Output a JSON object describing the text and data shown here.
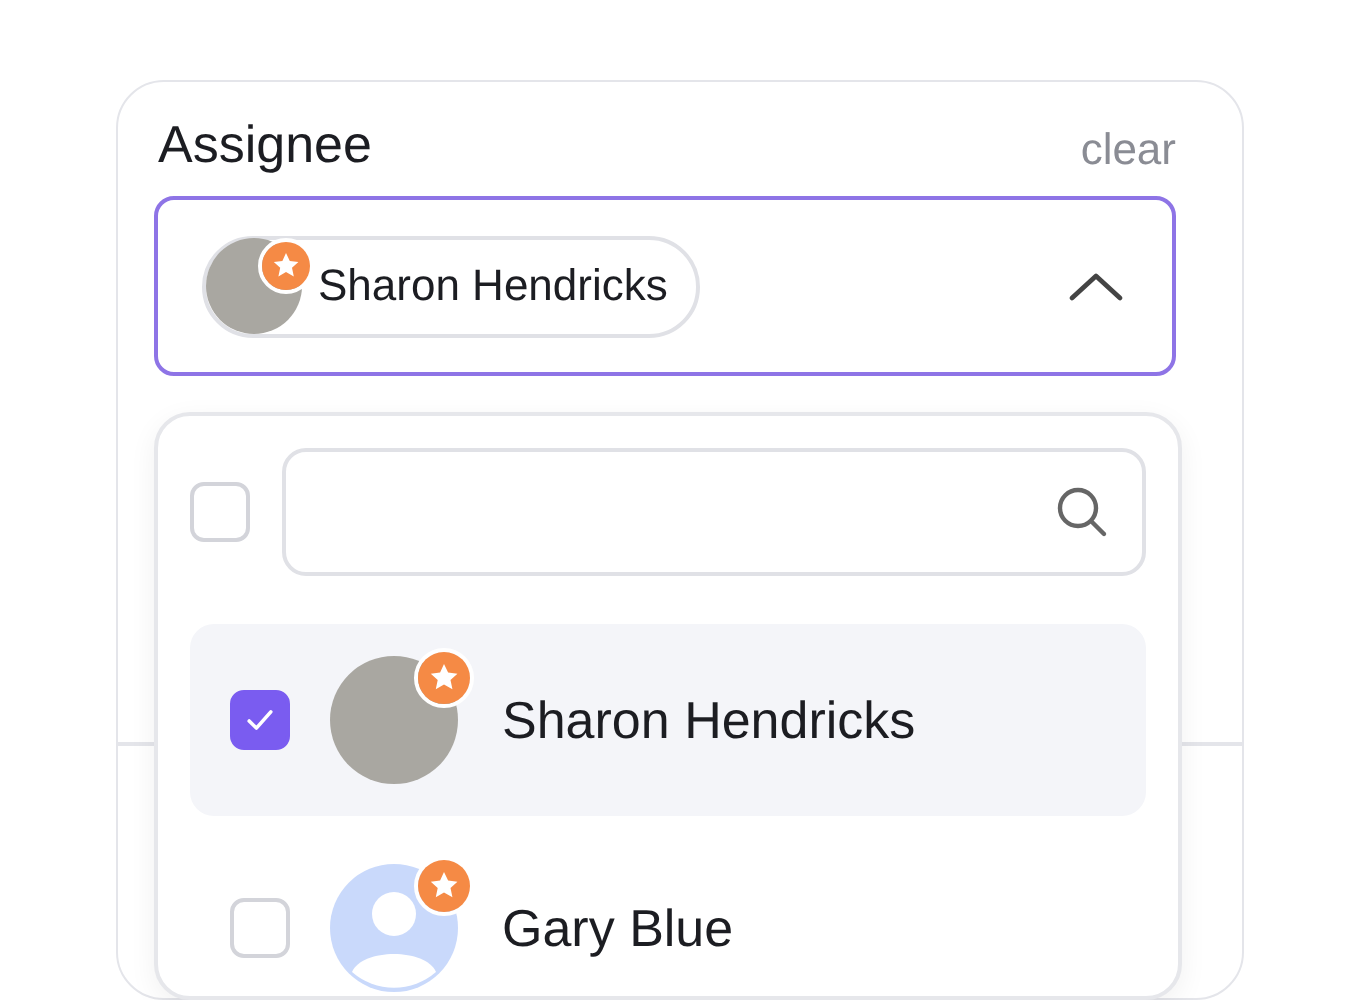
{
  "field": {
    "label": "Assignee",
    "clear": "clear",
    "open": true,
    "selected_chips": [
      {
        "name": "Sharon Hendricks",
        "kind": "photo",
        "starred": true
      }
    ]
  },
  "dropdown": {
    "select_all_checked": false,
    "options": [
      {
        "name": "Sharon Hendricks",
        "kind": "photo",
        "starred": true,
        "checked": true,
        "selected": true
      },
      {
        "name": "Gary Blue",
        "kind": "silhouette",
        "starred": true,
        "checked": false,
        "selected": false
      }
    ]
  }
}
